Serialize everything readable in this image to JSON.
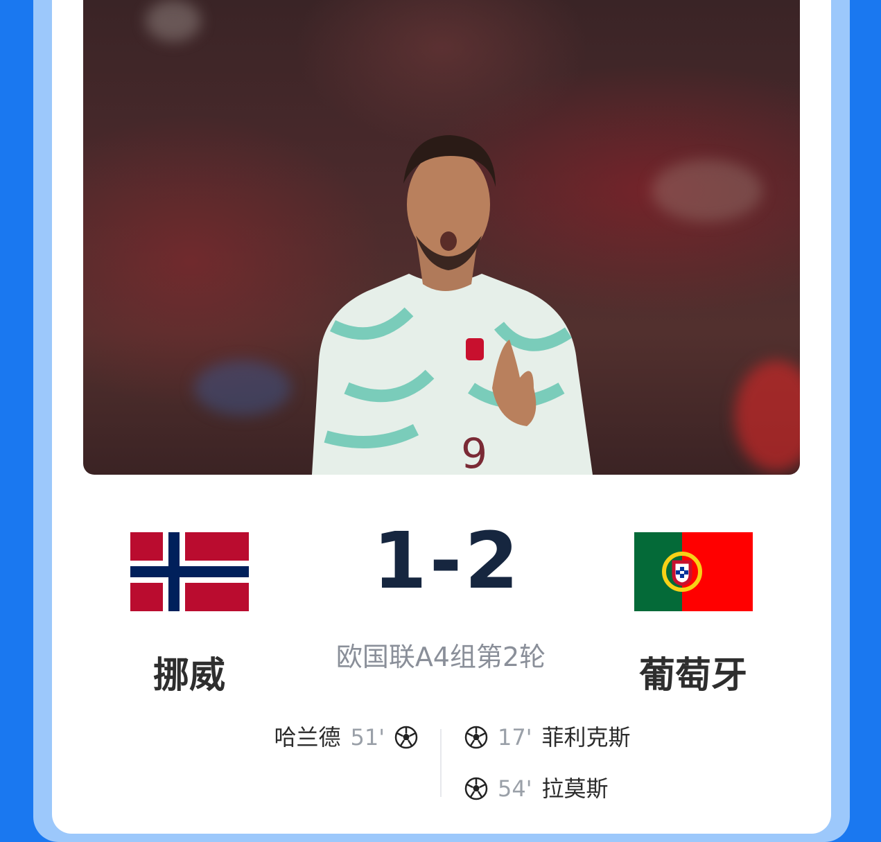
{
  "match": {
    "home_team": "挪威",
    "away_team": "葡萄牙",
    "score": "1-2",
    "competition_round": "欧国联A4组第2轮"
  },
  "goals": {
    "home": [
      {
        "player": "哈兰德",
        "minute": "51'"
      }
    ],
    "away": [
      {
        "player": "菲利克斯",
        "minute": "17'"
      },
      {
        "player": "拉莫斯",
        "minute": "54'"
      }
    ]
  },
  "colors": {
    "background_blue": "#1a78f0",
    "band_light_blue": "#9cc8fb",
    "score_navy": "#16263f",
    "norway_red": "#ba0c2f",
    "norway_blue": "#00205b",
    "portugal_green": "#046a38",
    "portugal_red": "#ff0000"
  },
  "icons": {
    "home_flag": "norway-flag",
    "away_flag": "portugal-flag",
    "goal_marker": "soccer-ball-icon",
    "hero": "player-celebration-photo"
  }
}
